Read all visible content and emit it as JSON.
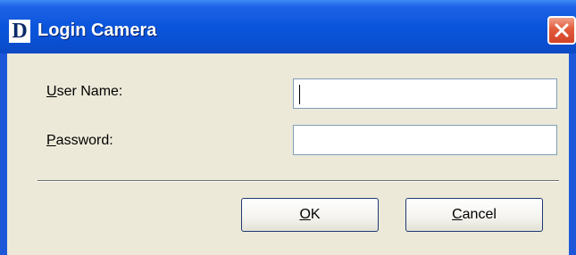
{
  "window": {
    "title": "Login Camera",
    "app_icon_letter": "D"
  },
  "form": {
    "username": {
      "label_accel": "U",
      "label_rest": "ser Name:",
      "value": ""
    },
    "password": {
      "label_accel": "P",
      "label_rest": "assword:",
      "value": ""
    }
  },
  "buttons": {
    "ok": {
      "accel": "O",
      "rest": "K"
    },
    "cancel": {
      "accel": "C",
      "rest": "ancel"
    }
  },
  "icons": {
    "app": "dlink-logo-icon",
    "close": "close-icon"
  },
  "colors": {
    "titlebar": "#0a55dc",
    "close_button": "#e35b3a",
    "dialog_background": "#ece9d8",
    "input_border": "#7f9db9"
  }
}
